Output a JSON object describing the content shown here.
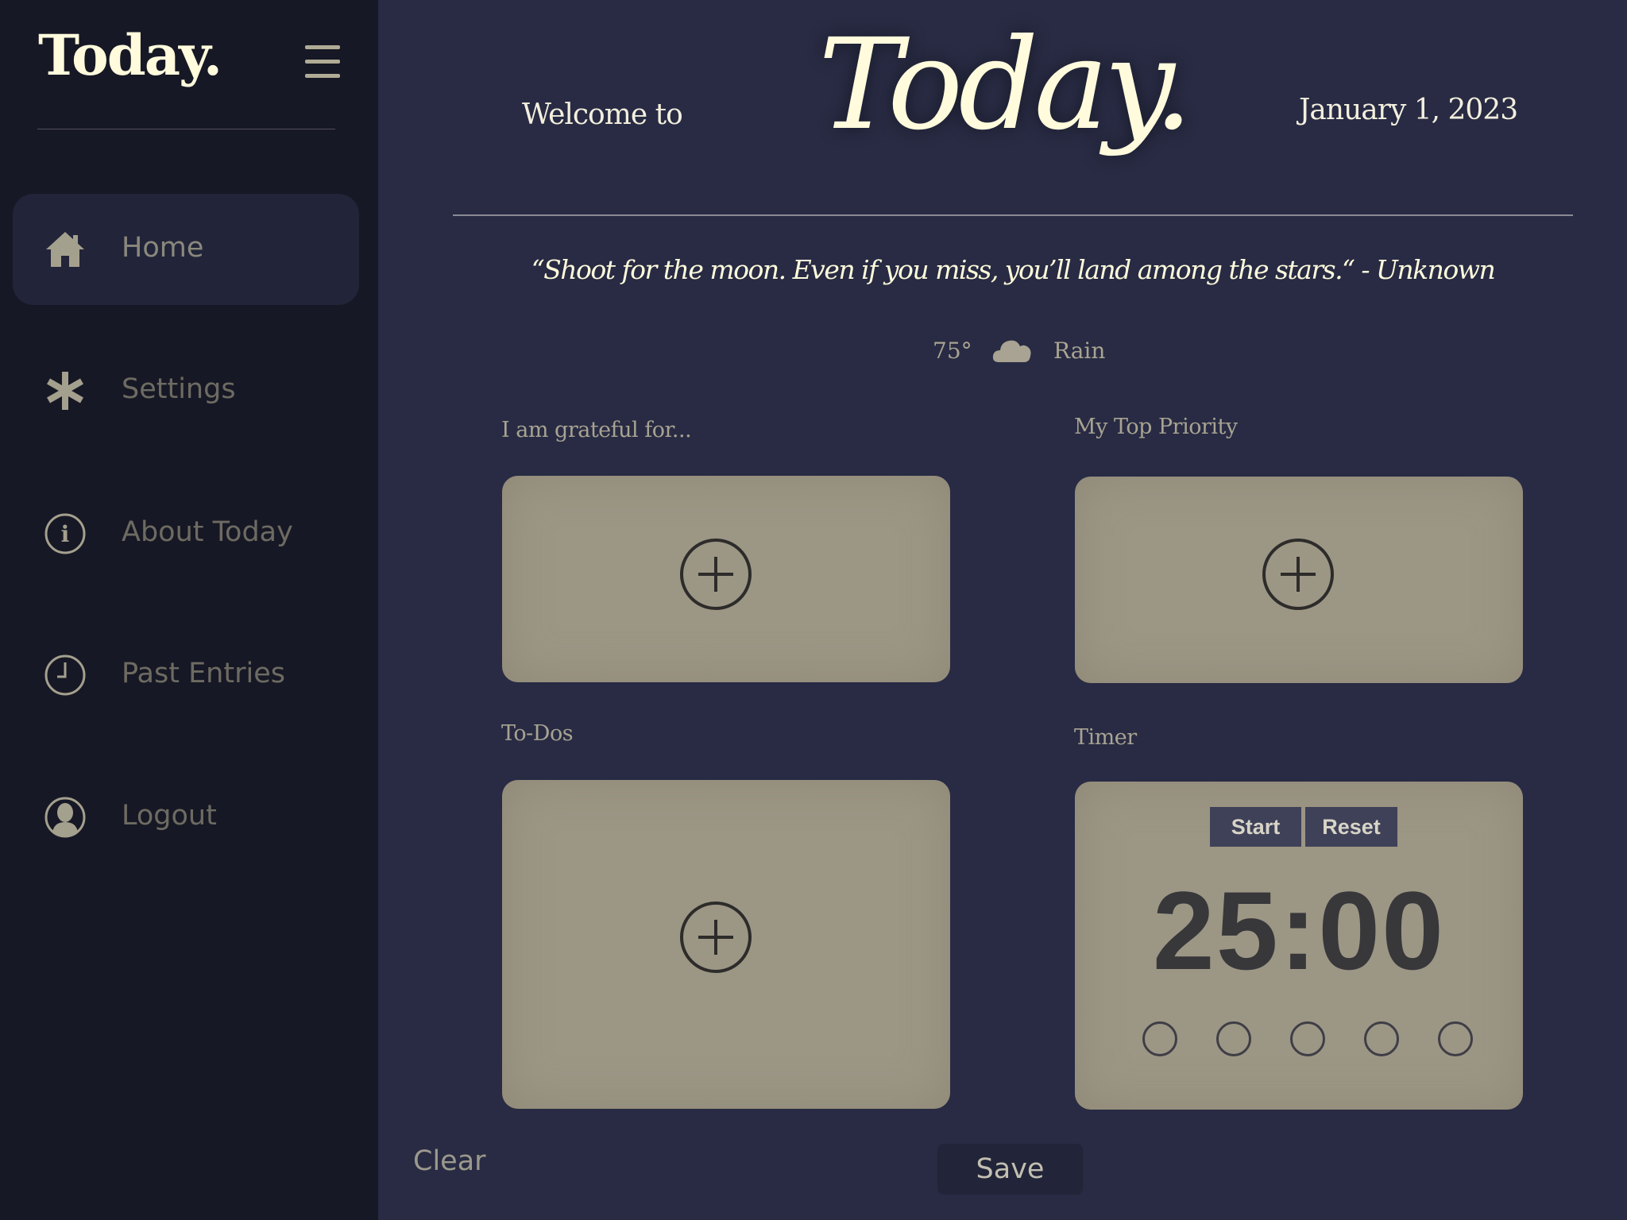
{
  "sidebar": {
    "brand": "Today.",
    "items": [
      {
        "label": "Home",
        "icon": "home-icon",
        "active": true
      },
      {
        "label": "Settings",
        "icon": "asterisk-icon"
      },
      {
        "label": "About Today",
        "icon": "info-icon"
      },
      {
        "label": "Past Entries",
        "icon": "clock-icon"
      },
      {
        "label": "Logout",
        "icon": "user-icon"
      }
    ]
  },
  "header": {
    "welcome": "Welcome to",
    "title": "Today.",
    "date": "January 1, 2023"
  },
  "quote": "“Shoot for the moon. Even if you miss, you’ll land among the stars.“ - Unknown",
  "weather": {
    "temperature": "75°",
    "condition": "Rain",
    "icon": "cloud-icon"
  },
  "sections": {
    "grateful": {
      "title": "I am grateful for..."
    },
    "priority": {
      "title": "My Top Priority"
    },
    "todos": {
      "title": "To-Dos"
    },
    "timer": {
      "title": "Timer",
      "start_label": "Start",
      "reset_label": "Reset",
      "display": "25:00",
      "session_dots": 5
    }
  },
  "actions": {
    "clear_label": "Clear",
    "save_label": "Save"
  },
  "colors": {
    "background": "#282b43",
    "sidebar": "#171825",
    "card": "#9c9685",
    "accent_cream": "#fffbdc"
  }
}
